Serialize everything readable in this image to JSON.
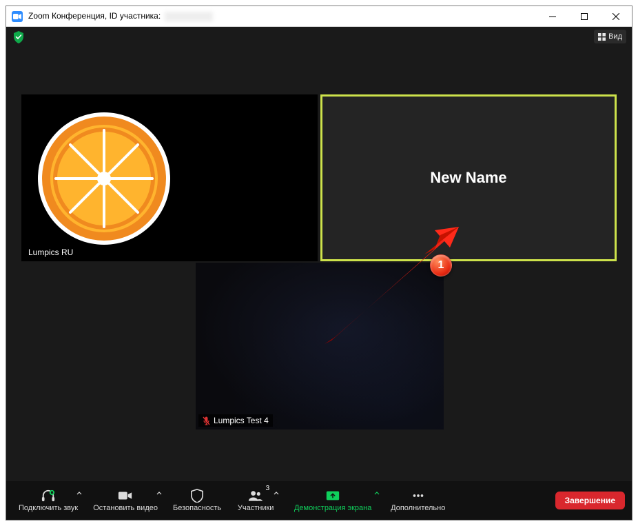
{
  "window": {
    "title_prefix": "Zoom Конференция, ID участника: "
  },
  "topbar": {
    "view_label": "Вид"
  },
  "participants": {
    "tile1_name": "Lumpics RU",
    "tile2_center": "New Name",
    "tile3_name": "Lumpics Test 4"
  },
  "annotation": {
    "marker": "1"
  },
  "toolbar": {
    "audio": "Подключить звук",
    "video": "Остановить видео",
    "security": "Безопасность",
    "participants": "Участники",
    "participants_count": "3",
    "share": "Демонстрация экрана",
    "more": "Дополнительно",
    "end": "Завершение"
  }
}
